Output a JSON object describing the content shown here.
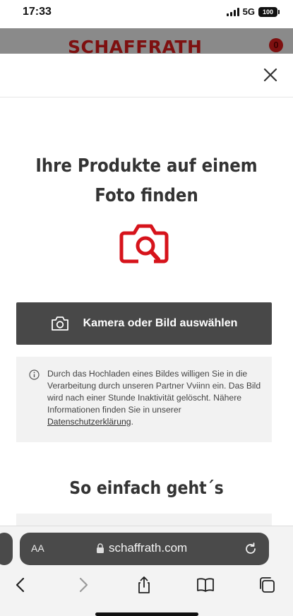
{
  "status_bar": {
    "time": "17:33",
    "network": "5G",
    "battery": "100"
  },
  "header": {
    "logo": "SCHAFFRATH",
    "cart_count": "0"
  },
  "modal": {
    "title": "Ihre Produkte auf einem Foto finden",
    "camera_button_label": "Kamera oder Bild auswählen",
    "info_text": "Durch das Hochladen eines Bildes willigen Sie in die Verarbeitung durch unseren Partner Vviinn ein. Das Bild wird nach einer Stunde Inaktivität gelöscht. Nähere Informationen finden Sie in unserer ",
    "info_link": "Datenschutzerklärung",
    "info_end": ".",
    "subtitle": "So einfach geht´s"
  },
  "browser": {
    "aa_label": "AA",
    "url": "schaffrath.com"
  },
  "colors": {
    "brand_red": "#d6131b",
    "button_dark": "#484848",
    "info_bg": "#f2f2f2"
  },
  "icons": [
    "close-icon",
    "photo-search-icon",
    "camera-icon",
    "info-icon",
    "lock-icon",
    "reload-icon",
    "back-icon",
    "forward-icon",
    "share-icon",
    "bookmarks-icon",
    "tabs-icon"
  ]
}
